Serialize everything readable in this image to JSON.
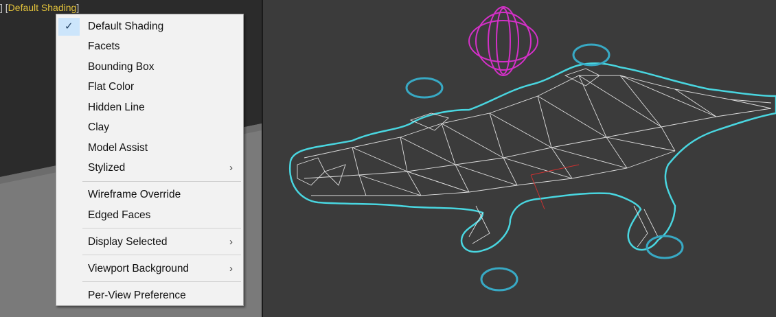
{
  "viewport": {
    "label_open": "[",
    "label_text": "Default Shading",
    "label_close": "]",
    "label_prefix": "]"
  },
  "colors": {
    "label_highlight": "#e2c23b",
    "wire_cyan": "#49d6e0",
    "wire_magenta": "#d430c8",
    "menu_check_bg": "#cce5fb"
  },
  "menu": {
    "items": [
      {
        "label": "Default Shading",
        "checked": true
      },
      {
        "label": "Facets"
      },
      {
        "label": "Bounding Box"
      },
      {
        "label": "Flat Color"
      },
      {
        "label": "Hidden Line"
      },
      {
        "label": "Clay"
      },
      {
        "label": "Model Assist"
      },
      {
        "label": "Stylized",
        "submenu": true
      },
      {
        "label": "Wireframe Override"
      },
      {
        "label": "Edged Faces"
      },
      {
        "label": "Display Selected",
        "submenu": true
      },
      {
        "label": "Viewport Background",
        "submenu": true
      },
      {
        "label": "Per-View Preference"
      }
    ],
    "check_glyph": "✓",
    "submenu_glyph": "›"
  },
  "icons": {
    "checkmark": "checkmark-icon",
    "submenu": "chevron-right-icon"
  }
}
